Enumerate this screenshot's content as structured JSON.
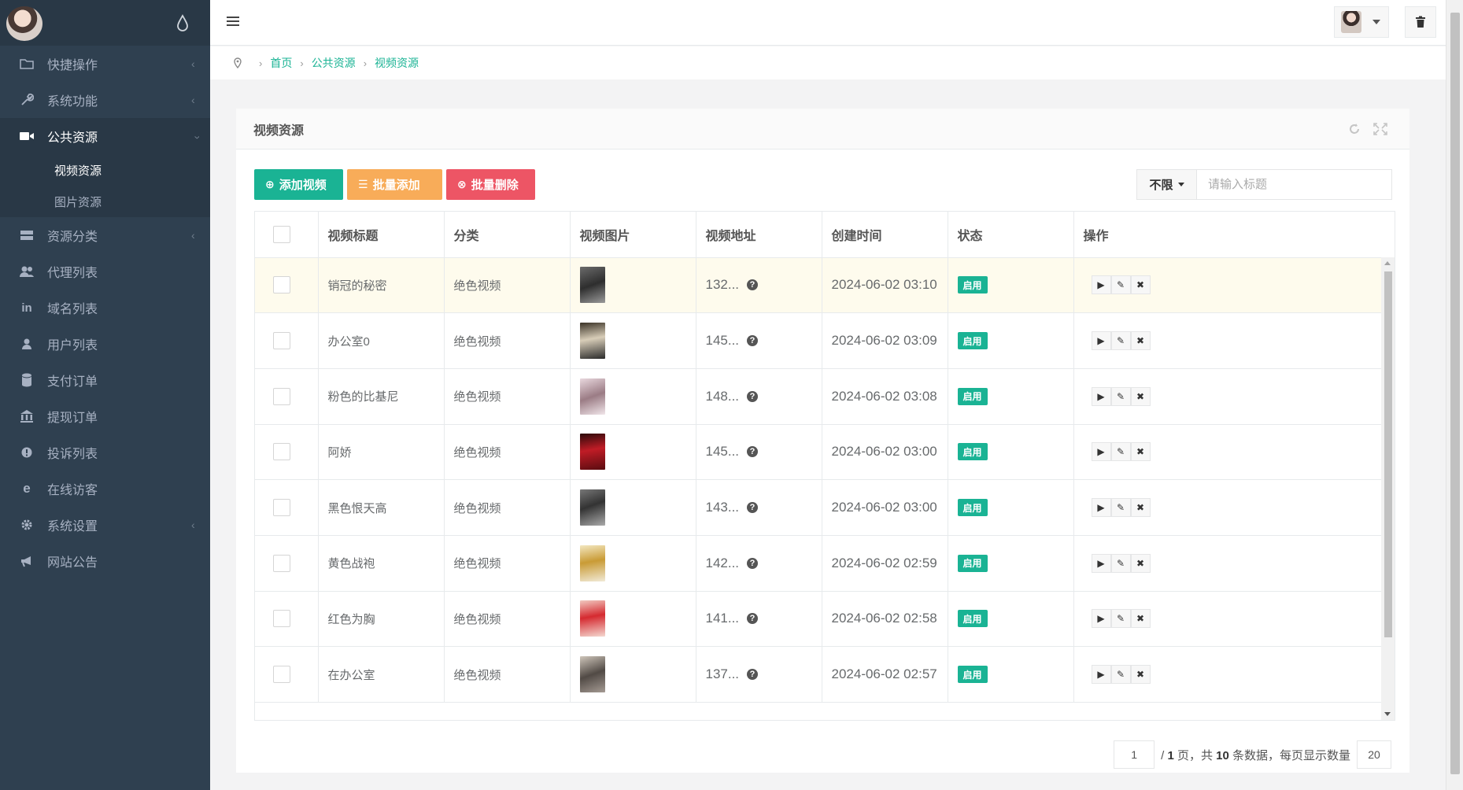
{
  "sidebar": {
    "items": [
      {
        "label": "快捷操作",
        "icon": "folder-icon",
        "arrow": true
      },
      {
        "label": "系统功能",
        "icon": "wrench-icon",
        "arrow": true
      },
      {
        "label": "公共资源",
        "icon": "video-camera-icon",
        "arrow": true,
        "active": true
      },
      {
        "label": "资源分类",
        "icon": "list-icon",
        "arrow": true
      },
      {
        "label": "代理列表",
        "icon": "users-icon",
        "arrow": false
      },
      {
        "label": "域名列表",
        "icon": "linkedin-icon",
        "arrow": false
      },
      {
        "label": "用户列表",
        "icon": "user-icon",
        "arrow": false
      },
      {
        "label": "支付订单",
        "icon": "database-icon",
        "arrow": false
      },
      {
        "label": "提现订单",
        "icon": "bank-icon",
        "arrow": false
      },
      {
        "label": "投诉列表",
        "icon": "exclamation-icon",
        "arrow": false
      },
      {
        "label": "在线访客",
        "icon": "ie-icon",
        "arrow": false
      },
      {
        "label": "系统设置",
        "icon": "gear-icon",
        "arrow": true
      },
      {
        "label": "网站公告",
        "icon": "bullhorn-icon",
        "arrow": false
      }
    ],
    "sub_items": [
      "视频资源",
      "图片资源"
    ]
  },
  "breadcrumb": [
    "首页",
    "公共资源",
    "视频资源"
  ],
  "panel": {
    "title": "视频资源",
    "buttons": {
      "add": "添加视频",
      "batch_add": "批量添加",
      "batch_delete": "批量删除"
    },
    "filter": "不限",
    "search_placeholder": "请输入标题"
  },
  "table": {
    "headers": [
      "视频标题",
      "分类",
      "视频图片",
      "视频地址",
      "创建时间",
      "状态",
      "操作"
    ],
    "rows": [
      {
        "title": "销冠的秘密",
        "category": "绝色视频",
        "url": "132...",
        "time": "2024-06-02 03:10",
        "status": "启用"
      },
      {
        "title": "办公室0",
        "category": "绝色视频",
        "url": "145...",
        "time": "2024-06-02 03:09",
        "status": "启用"
      },
      {
        "title": "粉色的比基尼",
        "category": "绝色视频",
        "url": "148...",
        "time": "2024-06-02 03:08",
        "status": "启用"
      },
      {
        "title": "阿娇",
        "category": "绝色视频",
        "url": "145...",
        "time": "2024-06-02 03:00",
        "status": "启用"
      },
      {
        "title": "黑色恨天高",
        "category": "绝色视频",
        "url": "143...",
        "time": "2024-06-02 03:00",
        "status": "启用"
      },
      {
        "title": "黄色战袍",
        "category": "绝色视频",
        "url": "142...",
        "time": "2024-06-02 02:59",
        "status": "启用"
      },
      {
        "title": "红色为胸",
        "category": "绝色视频",
        "url": "141...",
        "time": "2024-06-02 02:58",
        "status": "启用"
      },
      {
        "title": "在办公室",
        "category": "绝色视频",
        "url": "137...",
        "time": "2024-06-02 02:57",
        "status": "启用"
      }
    ]
  },
  "pager": {
    "page": "1",
    "text_pages": "/ ",
    "total_pages": "1",
    "text_mid": " 页，共 ",
    "total": "10",
    "text_end": " 条数据，每页显示数量",
    "per_page": "20"
  },
  "colors": {
    "primary": "#1ab394",
    "warning": "#f8ac59",
    "danger": "#ed5565",
    "sidebar": "#2f4050"
  }
}
